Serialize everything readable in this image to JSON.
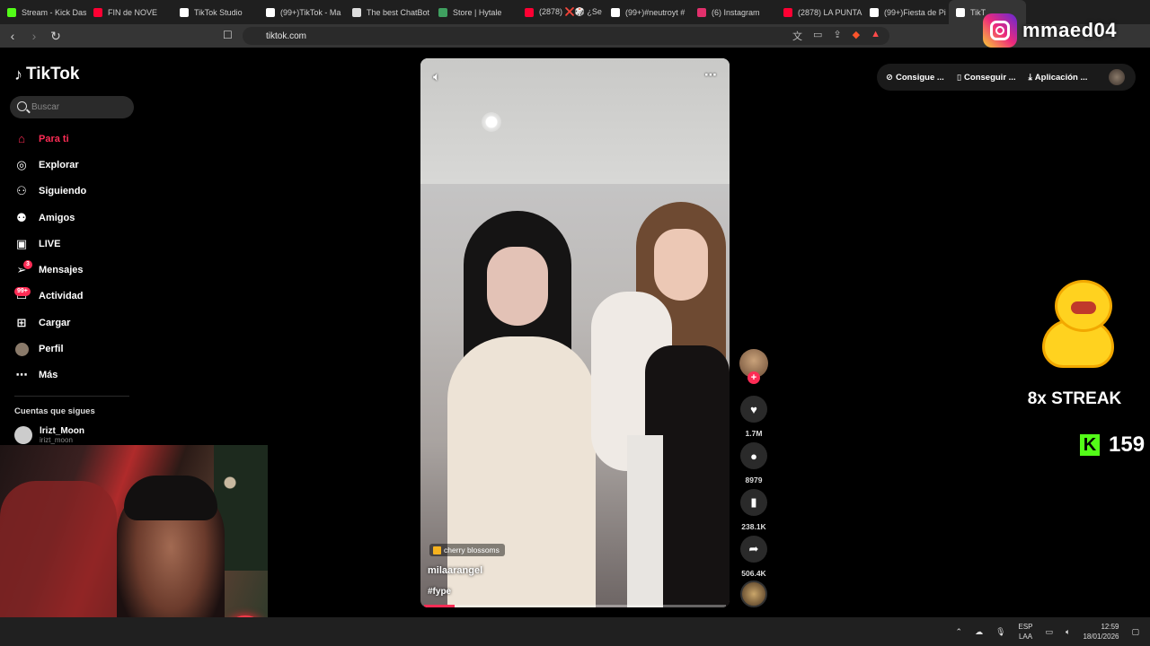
{
  "browser": {
    "tabs": [
      {
        "label": "Stream - Kick Das",
        "color": "#53fc18"
      },
      {
        "label": "FIN de NOVE",
        "color": "#ff0033"
      },
      {
        "label": "TikTok Studio",
        "color": "#ffffff"
      },
      {
        "label": "(99+)TikTok - Ma",
        "color": "#ffffff"
      },
      {
        "label": "The best ChatBot",
        "color": "#ffffff"
      },
      {
        "label": "Store | Hytale",
        "color": "#3fa060"
      },
      {
        "label": "(2878) ❌🎲 ¿Se",
        "color": "#ff0033"
      },
      {
        "label": "(99+)#neutroyt #",
        "color": "#ffffff"
      },
      {
        "label": "(6) Instagram",
        "color": "#e1306c"
      },
      {
        "label": "(2878) LA PUNTA",
        "color": "#ff0033"
      },
      {
        "label": "(99+)Fiesta de Pi",
        "color": "#ffffff"
      },
      {
        "label": "TikT",
        "color": "#ffffff"
      }
    ],
    "url": "tiktok.com"
  },
  "overlay": {
    "instagram_handle": "mmaed04",
    "streak_text": "8x STREAK",
    "kick_count": "159",
    "kick_letter": "K"
  },
  "sidebar": {
    "logo": "TikTok",
    "search_placeholder": "Buscar",
    "items": [
      {
        "label": "Para ti",
        "icon": "home-icon",
        "active": true
      },
      {
        "label": "Explorar",
        "icon": "compass-icon"
      },
      {
        "label": "Siguiendo",
        "icon": "following-icon"
      },
      {
        "label": "Amigos",
        "icon": "friends-icon"
      },
      {
        "label": "LIVE",
        "icon": "live-icon"
      },
      {
        "label": "Mensajes",
        "icon": "messages-icon",
        "badge": "3"
      },
      {
        "label": "Actividad",
        "icon": "activity-icon",
        "badge": "99+"
      },
      {
        "label": "Cargar",
        "icon": "upload-icon"
      },
      {
        "label": "Perfil",
        "icon": "profile-avatar"
      },
      {
        "label": "Más",
        "icon": "more-icon"
      }
    ],
    "following_title": "Cuentas que sigues",
    "following": [
      {
        "name": "lrizt_Moon",
        "handle": "irizt_moon"
      }
    ]
  },
  "video": {
    "music": "cherry blossoms",
    "author": "milaarangel",
    "caption": "#fype",
    "progress": 0.1
  },
  "actions": {
    "likes": "1.7M",
    "comments": "8979",
    "saves": "238.1K",
    "shares": "506.4K"
  },
  "header": {
    "items": [
      "Consigue ...",
      "Conseguir ...",
      "Aplicación ..."
    ]
  },
  "taskbar": {
    "lang_top": "ESP",
    "lang_bottom": "LAA",
    "time": "12:59",
    "date": "18/01/2026"
  }
}
